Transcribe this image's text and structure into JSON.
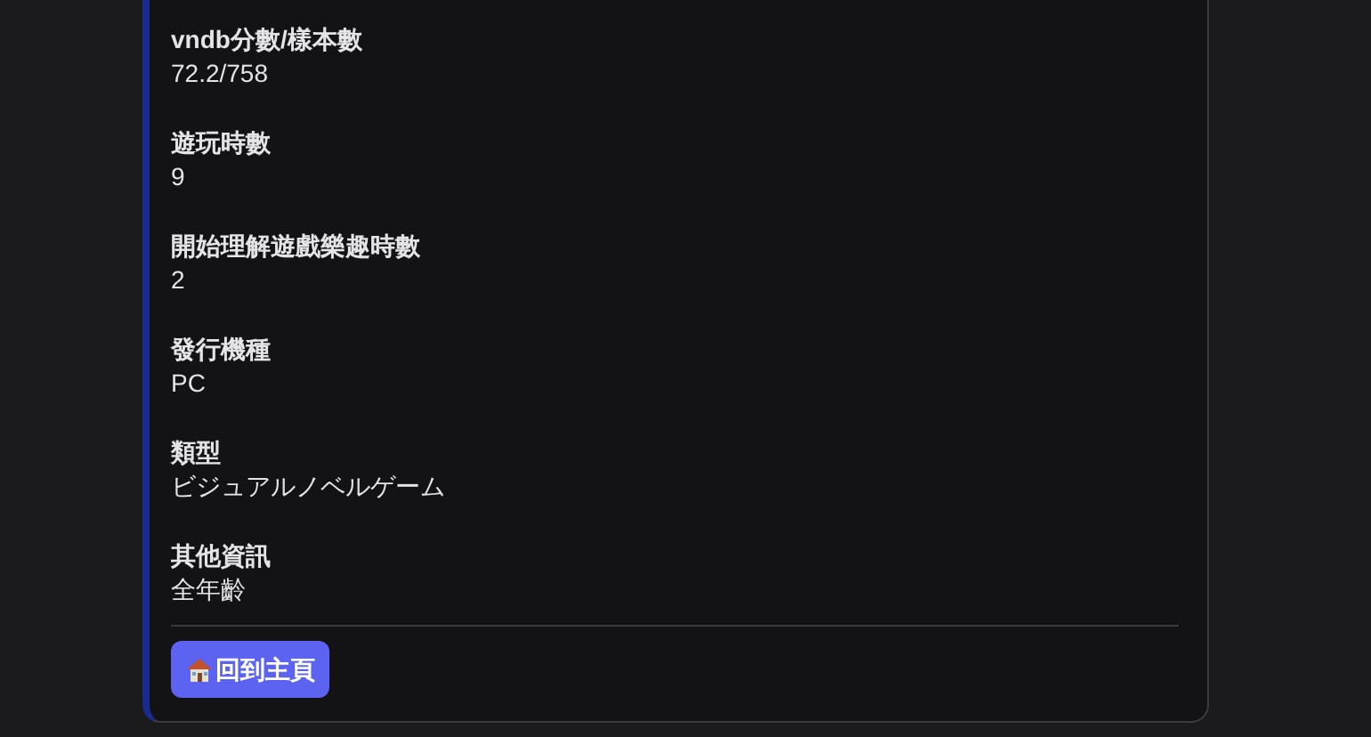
{
  "fields": [
    {
      "label": "vndb分數/樣本數",
      "value": "72.2/758"
    },
    {
      "label": "遊玩時數",
      "value": "9"
    },
    {
      "label": "開始理解遊戲樂趣時數",
      "value": "2"
    },
    {
      "label": "發行機種",
      "value": "PC"
    },
    {
      "label": "類型",
      "value": "ビジュアルノベルゲーム"
    },
    {
      "label": "其他資訊",
      "value": "全年齡"
    }
  ],
  "home_button": {
    "label": "回到主頁"
  }
}
